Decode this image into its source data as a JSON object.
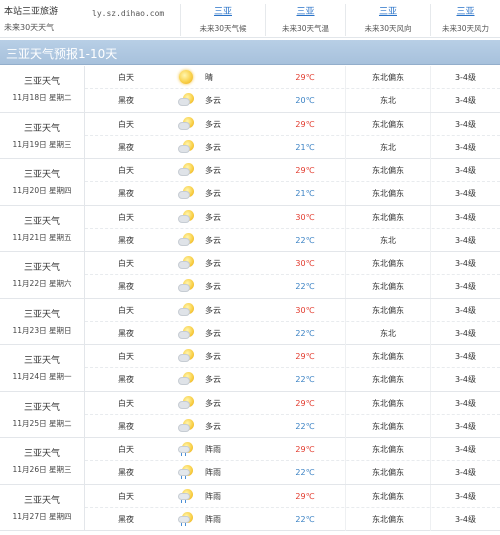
{
  "header": {
    "brand_line1": "本站三亚旅游",
    "brand_line2": "未来30天天气",
    "url": "ly.sz.dihao.com",
    "columns": [
      {
        "title": "三亚",
        "subtitle": "未来30天气候"
      },
      {
        "title": "三亚",
        "subtitle": "未来30天气温"
      },
      {
        "title": "三亚",
        "subtitle": "未来30天风向"
      },
      {
        "title": "三亚",
        "subtitle": "未来30天风力"
      }
    ]
  },
  "section_title": "三亚天气预报1-10天",
  "days": [
    {
      "name": "三亚天气",
      "date": "11月18日",
      "weekday": "星期二",
      "weekend": false,
      "rows": [
        {
          "time": "白天",
          "icon": "sun-icon",
          "desc": "晴",
          "temp": "29℃",
          "wind": "东北偏东",
          "level": "3-4级"
        },
        {
          "time": "黑夜",
          "icon": "partly-cloudy-icon",
          "desc": "多云",
          "temp": "20℃",
          "wind": "东北",
          "level": "3-4级"
        }
      ]
    },
    {
      "name": "三亚天气",
      "date": "11月19日",
      "weekday": "星期三",
      "weekend": false,
      "rows": [
        {
          "time": "白天",
          "icon": "partly-cloudy-icon",
          "desc": "多云",
          "temp": "29℃",
          "wind": "东北偏东",
          "level": "3-4级"
        },
        {
          "time": "黑夜",
          "icon": "partly-cloudy-icon",
          "desc": "多云",
          "temp": "21℃",
          "wind": "东北",
          "level": "3-4级"
        }
      ]
    },
    {
      "name": "三亚天气",
      "date": "11月20日",
      "weekday": "星期四",
      "weekend": false,
      "rows": [
        {
          "time": "白天",
          "icon": "partly-cloudy-icon",
          "desc": "多云",
          "temp": "29℃",
          "wind": "东北偏东",
          "level": "3-4级"
        },
        {
          "time": "黑夜",
          "icon": "partly-cloudy-icon",
          "desc": "多云",
          "temp": "21℃",
          "wind": "东北偏东",
          "level": "3-4级"
        }
      ]
    },
    {
      "name": "三亚天气",
      "date": "11月21日",
      "weekday": "星期五",
      "weekend": false,
      "rows": [
        {
          "time": "白天",
          "icon": "partly-cloudy-icon",
          "desc": "多云",
          "temp": "30℃",
          "wind": "东北偏东",
          "level": "3-4级"
        },
        {
          "time": "黑夜",
          "icon": "partly-cloudy-icon",
          "desc": "多云",
          "temp": "22℃",
          "wind": "东北",
          "level": "3-4级"
        }
      ]
    },
    {
      "name": "三亚天气",
      "date": "11月22日",
      "weekday": "星期六",
      "weekend": true,
      "rows": [
        {
          "time": "白天",
          "icon": "partly-cloudy-icon",
          "desc": "多云",
          "temp": "30℃",
          "wind": "东北偏东",
          "level": "3-4级"
        },
        {
          "time": "黑夜",
          "icon": "partly-cloudy-icon",
          "desc": "多云",
          "temp": "22℃",
          "wind": "东北偏东",
          "level": "3-4级"
        }
      ]
    },
    {
      "name": "三亚天气",
      "date": "11月23日",
      "weekday": "星期日",
      "weekend": true,
      "rows": [
        {
          "time": "白天",
          "icon": "partly-cloudy-icon",
          "desc": "多云",
          "temp": "30℃",
          "wind": "东北偏东",
          "level": "3-4级"
        },
        {
          "time": "黑夜",
          "icon": "partly-cloudy-icon",
          "desc": "多云",
          "temp": "22℃",
          "wind": "东北",
          "level": "3-4级"
        }
      ]
    },
    {
      "name": "三亚天气",
      "date": "11月24日",
      "weekday": "星期一",
      "weekend": false,
      "rows": [
        {
          "time": "白天",
          "icon": "partly-cloudy-icon",
          "desc": "多云",
          "temp": "29℃",
          "wind": "东北偏东",
          "level": "3-4级"
        },
        {
          "time": "黑夜",
          "icon": "partly-cloudy-icon",
          "desc": "多云",
          "temp": "22℃",
          "wind": "东北偏东",
          "level": "3-4级"
        }
      ]
    },
    {
      "name": "三亚天气",
      "date": "11月25日",
      "weekday": "星期二",
      "weekend": false,
      "rows": [
        {
          "time": "白天",
          "icon": "partly-cloudy-icon",
          "desc": "多云",
          "temp": "29℃",
          "wind": "东北偏东",
          "level": "3-4级"
        },
        {
          "time": "黑夜",
          "icon": "partly-cloudy-icon",
          "desc": "多云",
          "temp": "22℃",
          "wind": "东北偏东",
          "level": "3-4级"
        }
      ]
    },
    {
      "name": "三亚天气",
      "date": "11月26日",
      "weekday": "星期三",
      "weekend": false,
      "rows": [
        {
          "time": "白天",
          "icon": "rain-icon",
          "desc": "阵雨",
          "temp": "29℃",
          "wind": "东北偏东",
          "level": "3-4级"
        },
        {
          "time": "黑夜",
          "icon": "rain-icon",
          "desc": "阵雨",
          "temp": "22℃",
          "wind": "东北偏东",
          "level": "3-4级"
        }
      ]
    },
    {
      "name": "三亚天气",
      "date": "11月27日",
      "weekday": "星期四",
      "weekend": false,
      "rows": [
        {
          "time": "白天",
          "icon": "rain-icon",
          "desc": "阵雨",
          "temp": "29℃",
          "wind": "东北偏东",
          "level": "3-4级"
        },
        {
          "time": "黑夜",
          "icon": "rain-icon",
          "desc": "阵雨",
          "temp": "22℃",
          "wind": "东北偏东",
          "level": "3-4级"
        }
      ]
    }
  ]
}
